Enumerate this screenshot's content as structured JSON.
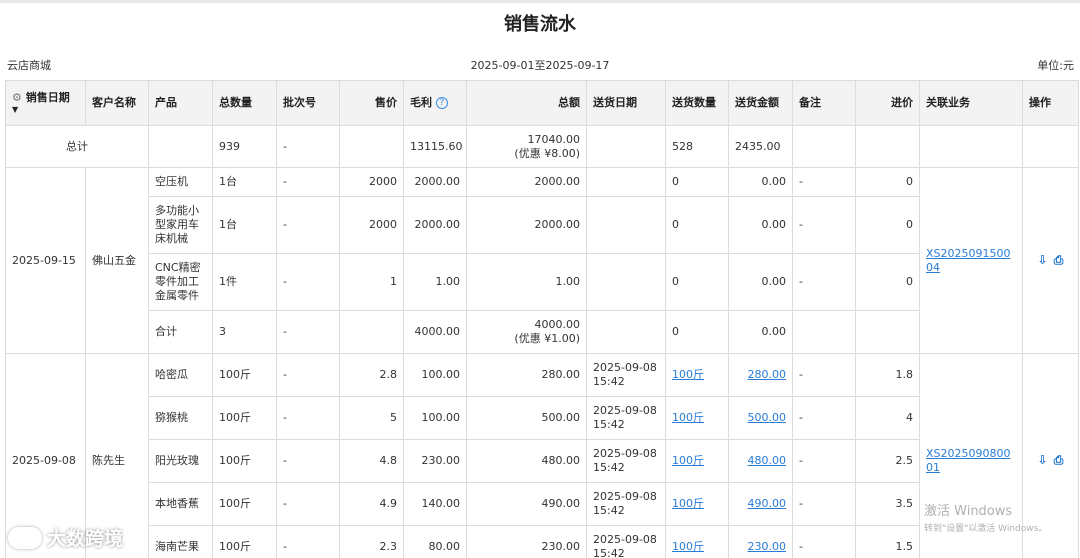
{
  "page": {
    "title": "销售流水",
    "store": "云店商城",
    "date_range": "2025-09-01至2025-09-17",
    "unit": "单位:元"
  },
  "columns": [
    "销售日期",
    "客户名称",
    "产品",
    "总数量",
    "批次号",
    "售价",
    "毛利",
    "总额",
    "送货日期",
    "送货数量",
    "送货金额",
    "备注",
    "进价",
    "关联业务",
    "操作"
  ],
  "total_row": {
    "label": "总计",
    "qty": "939",
    "batch": "-",
    "profit": "13115.60",
    "amount": "17040.00",
    "amount_discount": "(优惠 ¥8.00)",
    "deliver_qty": "528",
    "deliver_amount": "2435.00"
  },
  "groups": [
    {
      "date": "2025-09-15",
      "customer": "佛山五金",
      "link": "XS202509150004",
      "items": [
        {
          "product": "空压机",
          "qty": "1台",
          "batch": "-",
          "price": "2000",
          "profit": "2000.00",
          "amount": "2000.00",
          "deliver_date": "",
          "deliver_qty": "0",
          "deliver_amount": "0.00",
          "note": "-",
          "cost": "0"
        },
        {
          "product": "多功能小型家用车床机械",
          "qty": "1台",
          "batch": "-",
          "price": "2000",
          "profit": "2000.00",
          "amount": "2000.00",
          "deliver_date": "",
          "deliver_qty": "0",
          "deliver_amount": "0.00",
          "note": "-",
          "cost": "0"
        },
        {
          "product": "CNC精密零件加工金属零件",
          "qty": "1件",
          "batch": "-",
          "price": "1",
          "profit": "1.00",
          "amount": "1.00",
          "deliver_date": "",
          "deliver_qty": "0",
          "deliver_amount": "0.00",
          "note": "-",
          "cost": "0"
        }
      ],
      "subtotal": {
        "label": "合计",
        "qty": "3",
        "batch": "-",
        "profit": "4000.00",
        "amount": "4000.00",
        "amount_discount": "(优惠 ¥1.00)",
        "deliver_qty": "0",
        "deliver_amount": "0.00"
      }
    },
    {
      "date": "2025-09-08",
      "customer": "陈先生",
      "link": "XS202509080001",
      "items": [
        {
          "product": "哈密瓜",
          "qty": "100斤",
          "batch": "-",
          "price": "2.8",
          "profit": "100.00",
          "amount": "280.00",
          "deliver_date": "2025-09-08 15:42",
          "deliver_qty": "100斤",
          "deliver_amount": "280.00",
          "note": "-",
          "cost": "1.8"
        },
        {
          "product": "猕猴桃",
          "qty": "100斤",
          "batch": "-",
          "price": "5",
          "profit": "100.00",
          "amount": "500.00",
          "deliver_date": "2025-09-08 15:42",
          "deliver_qty": "100斤",
          "deliver_amount": "500.00",
          "note": "-",
          "cost": "4"
        },
        {
          "product": "阳光玫瑰",
          "qty": "100斤",
          "batch": "-",
          "price": "4.8",
          "profit": "230.00",
          "amount": "480.00",
          "deliver_date": "2025-09-08 15:42",
          "deliver_qty": "100斤",
          "deliver_amount": "480.00",
          "note": "-",
          "cost": "2.5"
        },
        {
          "product": "本地香蕉",
          "qty": "100斤",
          "batch": "-",
          "price": "4.9",
          "profit": "140.00",
          "amount": "490.00",
          "deliver_date": "2025-09-08 15:42",
          "deliver_qty": "100斤",
          "deliver_amount": "490.00",
          "note": "-",
          "cost": "3.5"
        },
        {
          "product": "海南芒果",
          "qty": "100斤",
          "batch": "-",
          "price": "2.3",
          "profit": "80.00",
          "amount": "230.00",
          "deliver_date": "2025-09-08 15:42",
          "deliver_qty": "100斤",
          "deliver_amount": "230.00",
          "note": "-",
          "cost": "1.5"
        }
      ]
    }
  ],
  "icons": {
    "settings": "gear-icon",
    "help": "help-circle-icon",
    "export": "download-icon",
    "print": "print-icon"
  },
  "overlay": {
    "watermark_title": "激活 Windows",
    "watermark_sub": "转到\"设置\"以激活 Windows。",
    "brand": "大数跨境"
  },
  "colors": {
    "link": "#2a7cd4",
    "header_bg": "#f3f3f3",
    "border": "#dcdcdc"
  }
}
